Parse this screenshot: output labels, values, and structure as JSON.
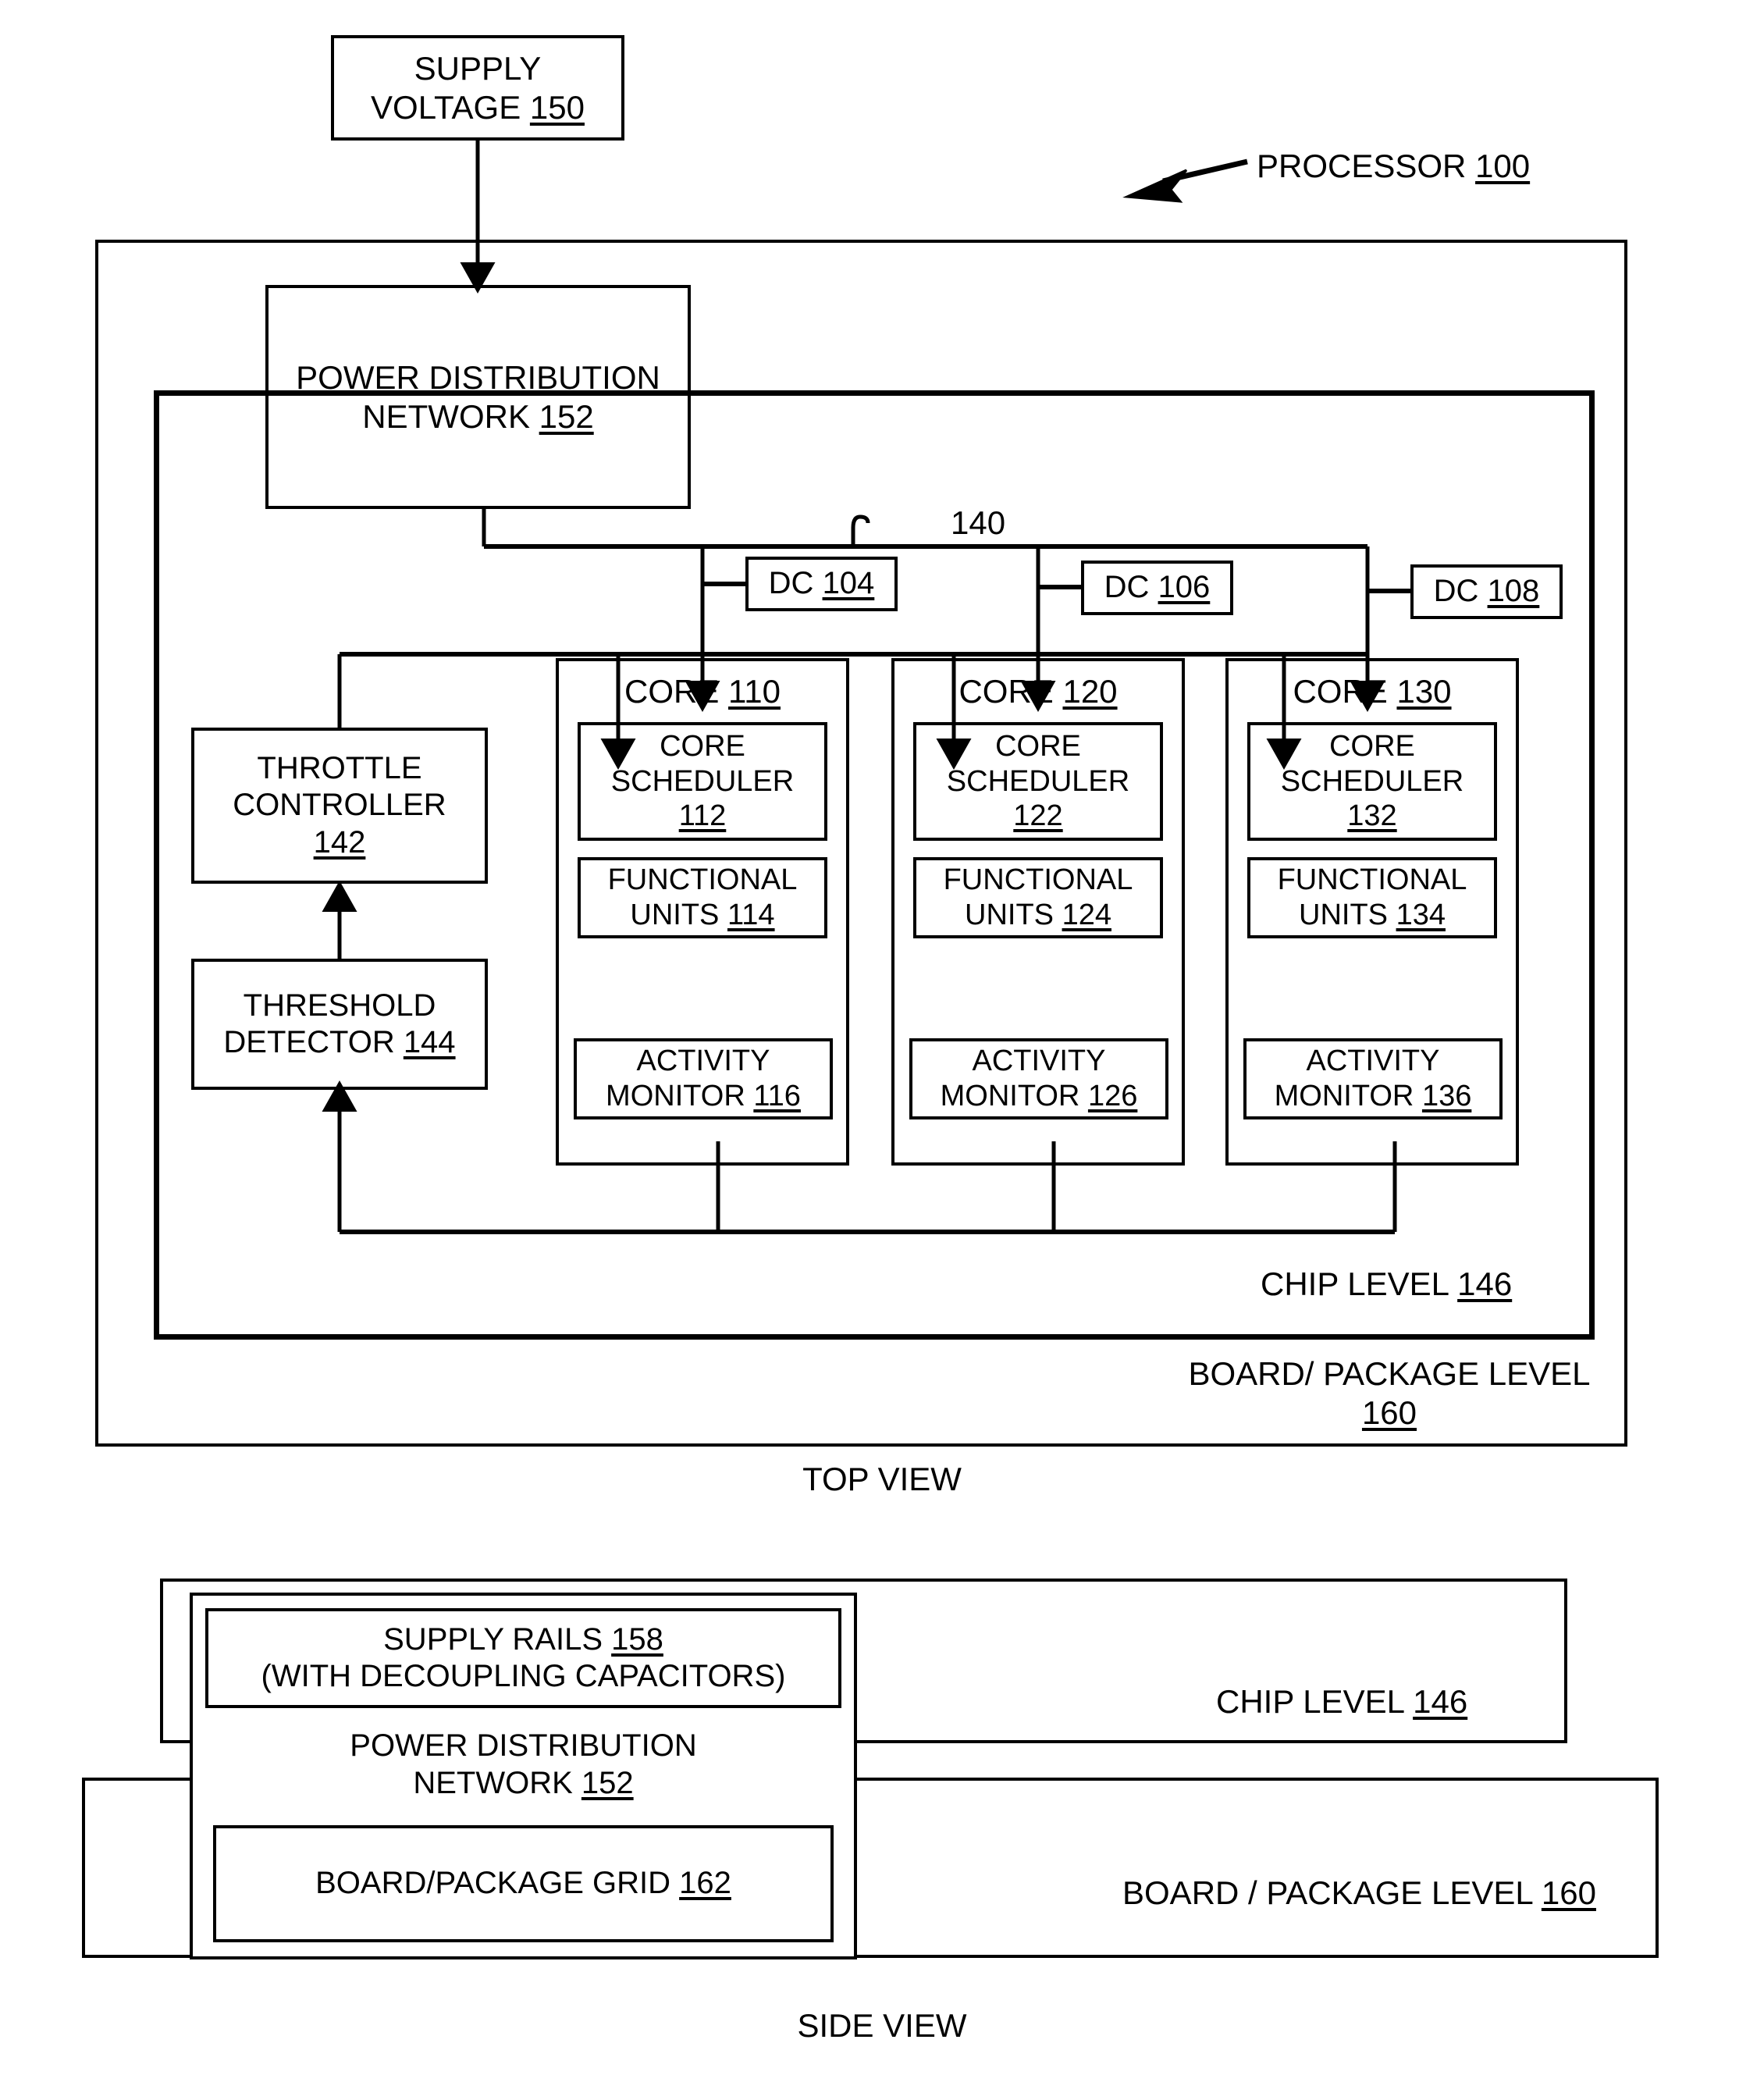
{
  "figure": {
    "processor_callout": "PROCESSOR 100",
    "processor_callout_main": "PROCESSOR ",
    "processor_callout_num": "100",
    "top_view_caption": "TOP VIEW",
    "side_view_caption": "SIDE VIEW",
    "bus_label": "140"
  },
  "top_view": {
    "supply_voltage": {
      "line1": "SUPPLY",
      "line2_text": "VOLTAGE ",
      "line2_num": "150"
    },
    "pdn": {
      "line1": "POWER DISTRIBUTION",
      "line2_text": "NETWORK ",
      "line2_num": "152"
    },
    "dc_blocks": [
      {
        "text": "DC ",
        "num": "104"
      },
      {
        "text": "DC ",
        "num": "106"
      },
      {
        "text": "DC ",
        "num": "108"
      }
    ],
    "throttle_controller": {
      "line1": "THROTTLE",
      "line2": "CONTROLLER",
      "num": "142"
    },
    "threshold_detector": {
      "line1": "THRESHOLD",
      "line2_text": "DETECTOR ",
      "line2_num": "144"
    },
    "cores": [
      {
        "header_text": "CORE ",
        "header_num": "110",
        "scheduler": {
          "line1": "CORE",
          "line2": "SCHEDULER",
          "num": "112"
        },
        "functional_units": {
          "line1": "FUNCTIONAL",
          "line2_text": "UNITS ",
          "line2_num": "114"
        },
        "activity_monitor": {
          "line1": "ACTIVITY",
          "line2_text": "MONITOR ",
          "line2_num": "116"
        }
      },
      {
        "header_text": "CORE ",
        "header_num": "120",
        "scheduler": {
          "line1": "CORE",
          "line2": "SCHEDULER",
          "num": "122"
        },
        "functional_units": {
          "line1": "FUNCTIONAL",
          "line2_text": "UNITS ",
          "line2_num": "124"
        },
        "activity_monitor": {
          "line1": "ACTIVITY",
          "line2_text": "MONITOR ",
          "line2_num": "126"
        }
      },
      {
        "header_text": "CORE ",
        "header_num": "130",
        "scheduler": {
          "line1": "CORE",
          "line2": "SCHEDULER",
          "num": "132"
        },
        "functional_units": {
          "line1": "FUNCTIONAL",
          "line2_text": "UNITS ",
          "line2_num": "134"
        },
        "activity_monitor": {
          "line1": "ACTIVITY",
          "line2_text": "MONITOR ",
          "line2_num": "136"
        }
      }
    ],
    "chip_level": {
      "text": "CHIP LEVEL ",
      "num": "146"
    },
    "board_level": {
      "line1": "BOARD/ PACKAGE LEVEL",
      "num": "160"
    }
  },
  "side_view": {
    "supply_rails": {
      "line1_text": "SUPPLY RAILS ",
      "line1_num": "158",
      "line2": "(WITH DECOUPLING CAPACITORS)"
    },
    "pdn": {
      "line1": "POWER DISTRIBUTION",
      "line2_text": "NETWORK ",
      "line2_num": "152"
    },
    "board_grid": {
      "text": "BOARD/PACKAGE  GRID ",
      "num": "162"
    },
    "chip_level": {
      "text": "CHIP LEVEL ",
      "num": "146"
    },
    "board_level": {
      "text": "BOARD / PACKAGE LEVEL ",
      "num": "160"
    }
  },
  "colors": {
    "ink": "#000000",
    "paper": "#ffffff"
  }
}
